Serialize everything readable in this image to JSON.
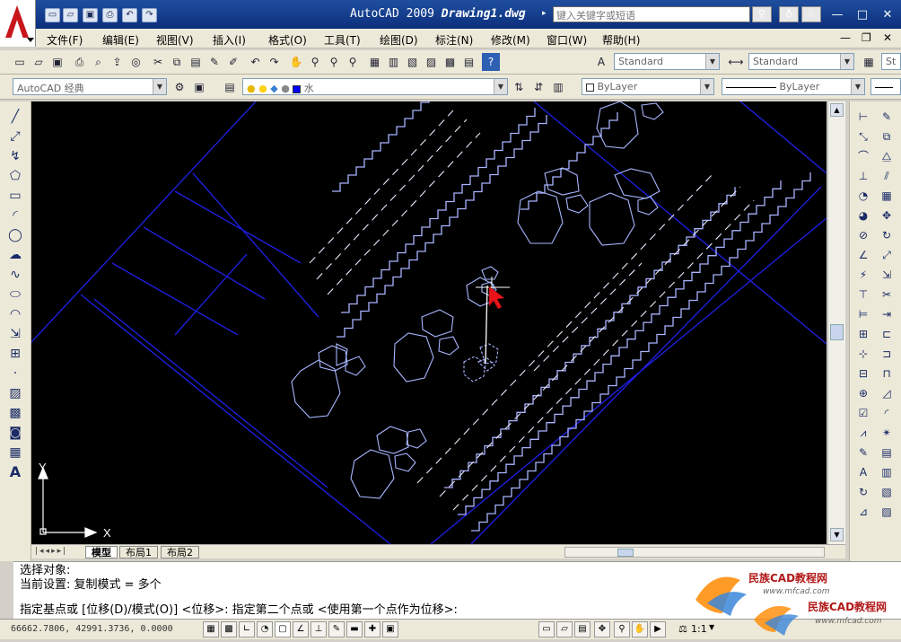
{
  "window": {
    "app_title": "AutoCAD 2009",
    "file_name": "Drawing1.dwg",
    "search_placeholder": "键入关键字或短语",
    "controls": {
      "minimize": "—",
      "restore": "□",
      "close": "✕"
    },
    "doc_controls": {
      "minimize": "—",
      "restore": "❐",
      "close": "✕"
    }
  },
  "menus": [
    "文件(F)",
    "编辑(E)",
    "视图(V)",
    "插入(I)",
    "格式(O)",
    "工具(T)",
    "绘图(D)",
    "标注(N)",
    "修改(M)",
    "窗口(W)",
    "帮助(H)"
  ],
  "toolbars": {
    "text_style": "Standard",
    "dim_style": "Standard",
    "table_style": "St",
    "workspace": "AutoCAD 经典",
    "layer": "水",
    "color": "ByLayer",
    "linetype": "ByLayer"
  },
  "canvas": {
    "ucs_x": "X",
    "ucs_y": "Y",
    "colors": {
      "background": "#000000",
      "walls": "#1e1edc",
      "lines": "#ffffff",
      "trees": "#a8b6ff"
    }
  },
  "layout_tabs": [
    "模型",
    "布局1",
    "布局2"
  ],
  "command_lines": [
    "选择对象:",
    "当前设置:   复制模式 = 多个",
    "指定基点或 [位移(D)/模式(O)] <位移>: 指定第二个点或 <使用第一个点作为位移>:"
  ],
  "status": {
    "coords": "66662.7806, 42991.3736, 0.0000",
    "scale": "1:1"
  },
  "watermark": {
    "text": "民族CAD教程网",
    "url": "www.mfcad.com"
  }
}
